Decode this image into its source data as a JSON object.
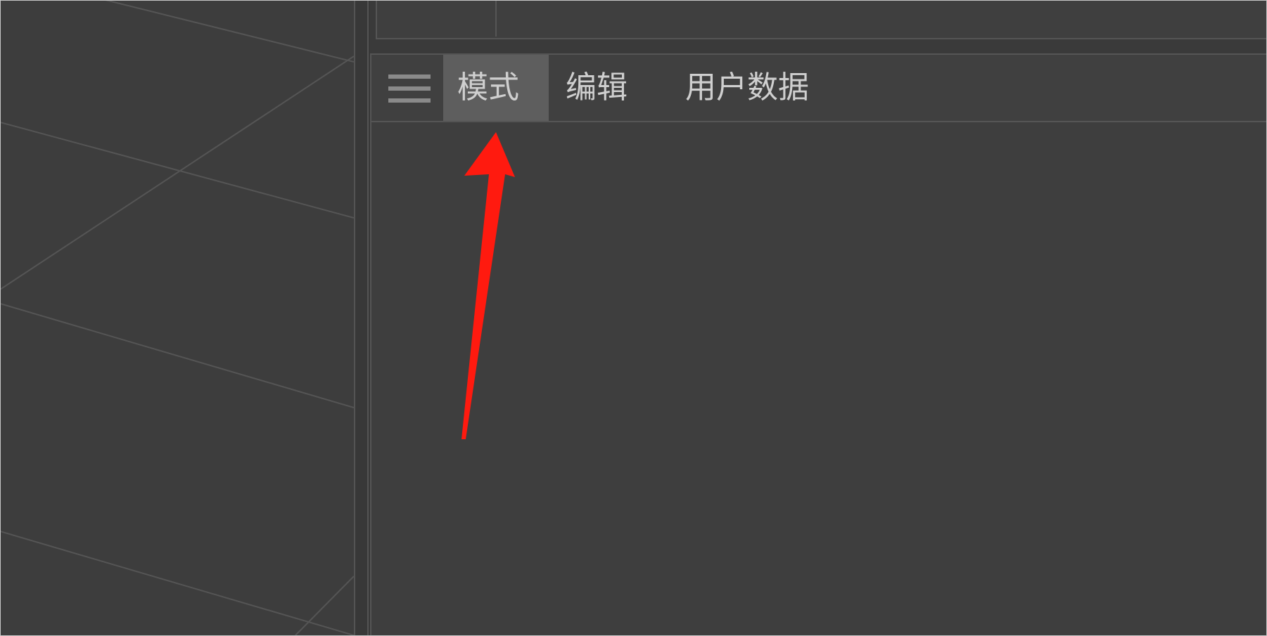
{
  "menu": {
    "hamburger_icon": "hamburger-menu-icon",
    "items": [
      {
        "label": "模式",
        "active": true
      },
      {
        "label": "编辑",
        "active": false
      },
      {
        "label": "用户数据",
        "active": false
      }
    ]
  },
  "annotation": {
    "icon": "red-arrow-annotation",
    "color": "#ff1a0f"
  },
  "colors": {
    "viewport_bg": "#3d3d3d",
    "panel_bg": "#3e3e3e",
    "active_tab_bg": "#5e5e5e",
    "text": "#cfcfcf"
  }
}
